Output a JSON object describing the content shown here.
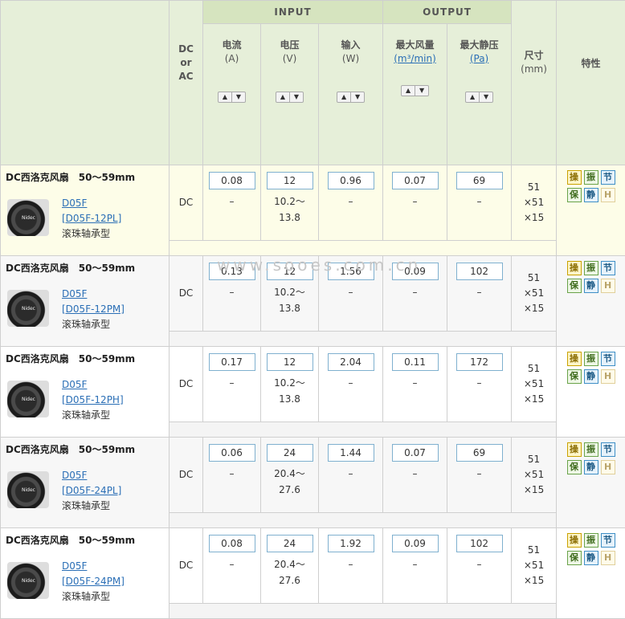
{
  "header": {
    "input_group": "INPUT",
    "output_group": "OUTPUT",
    "dc_ac": "DC\nor\nAC",
    "current": "电流",
    "current_unit": "(A)",
    "voltage": "电压",
    "voltage_unit": "(V)",
    "power": "输入",
    "power_unit": "(W)",
    "airflow": "最大风量",
    "airflow_unit": "(m³/min)",
    "pressure": "最大静压",
    "pressure_unit": "(Pa)",
    "size": "尺寸",
    "size_unit": "(mm)",
    "features": "特性"
  },
  "rows": [
    {
      "name": "DC西洛克风扇　50〜59mm",
      "series": "D05F",
      "model": "[D05F-12PL]",
      "bearing": "滚珠轴承型",
      "type": "DC",
      "current": "0.08",
      "voltage": "12",
      "voltage_range": "10.2〜",
      "voltage_range2": "13.8",
      "power": "0.96",
      "airflow": "0.07",
      "pressure": "69",
      "dash": "–",
      "d1": "51",
      "d2": "×51",
      "d3": "×15"
    },
    {
      "name": "DC西洛克风扇　50〜59mm",
      "series": "D05F",
      "model": "[D05F-12PM]",
      "bearing": "滚珠轴承型",
      "type": "DC",
      "current": "0.13",
      "voltage": "12",
      "voltage_range": "10.2〜",
      "voltage_range2": "13.8",
      "power": "1.56",
      "airflow": "0.09",
      "pressure": "102",
      "dash": "–",
      "d1": "51",
      "d2": "×51",
      "d3": "×15"
    },
    {
      "name": "DC西洛克风扇　50〜59mm",
      "series": "D05F",
      "model": "[D05F-12PH]",
      "bearing": "滚珠轴承型",
      "type": "DC",
      "current": "0.17",
      "voltage": "12",
      "voltage_range": "10.2〜",
      "voltage_range2": "13.8",
      "power": "2.04",
      "airflow": "0.11",
      "pressure": "172",
      "dash": "–",
      "d1": "51",
      "d2": "×51",
      "d3": "×15"
    },
    {
      "name": "DC西洛克风扇　50〜59mm",
      "series": "D05F",
      "model": "[D05F-24PL]",
      "bearing": "滚珠轴承型",
      "type": "DC",
      "current": "0.06",
      "voltage": "24",
      "voltage_range": "20.4〜",
      "voltage_range2": "27.6",
      "power": "1.44",
      "airflow": "0.07",
      "pressure": "69",
      "dash": "–",
      "d1": "51",
      "d2": "×51",
      "d3": "×15"
    },
    {
      "name": "DC西洛克风扇　50〜59mm",
      "series": "D05F",
      "model": "[D05F-24PM]",
      "bearing": "滚珠轴承型",
      "type": "DC",
      "current": "0.08",
      "voltage": "24",
      "voltage_range": "20.4〜",
      "voltage_range2": "27.6",
      "power": "1.92",
      "airflow": "0.09",
      "pressure": "102",
      "dash": "–",
      "d1": "51",
      "d2": "×51",
      "d3": "×15"
    }
  ],
  "badges": [
    "操",
    "振",
    "节",
    "保",
    "静",
    "H"
  ],
  "watermark": "www.sooes.com.cn",
  "logo": "Nidec"
}
